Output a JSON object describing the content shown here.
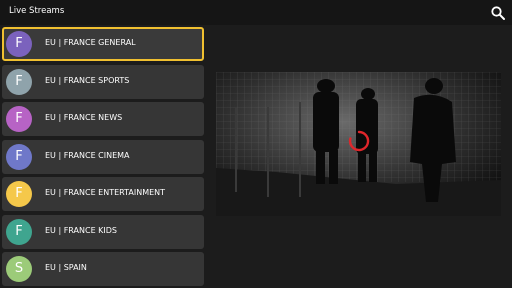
{
  "header": {
    "title": "Live Streams",
    "search_icon": "search-icon"
  },
  "channels": [
    {
      "letter": "F",
      "name": "EU | FRANCE GENERAL",
      "color": "#7b62bd",
      "selected": true
    },
    {
      "letter": "F",
      "name": "EU | FRANCE SPORTS",
      "color": "#8fa3ab",
      "selected": false
    },
    {
      "letter": "F",
      "name": "EU | FRANCE NEWS",
      "color": "#b763c5",
      "selected": false
    },
    {
      "letter": "F",
      "name": "EU | FRANCE CINEMA",
      "color": "#6f78c9",
      "selected": false
    },
    {
      "letter": "F",
      "name": "EU | FRANCE ENTERTAINMENT",
      "color": "#f5c84a",
      "selected": false
    },
    {
      "letter": "F",
      "name": "EU | FRANCE KIDS",
      "color": "#3fa58f",
      "selected": false
    },
    {
      "letter": "S",
      "name": "EU | SPAIN",
      "color": "#9ccb79",
      "selected": false
    }
  ],
  "player": {
    "state": "loading",
    "spinner_color": "#e0262b"
  },
  "colors": {
    "accent": "#f0c030",
    "background": "#1c1c1c",
    "item_background": "#363636"
  }
}
